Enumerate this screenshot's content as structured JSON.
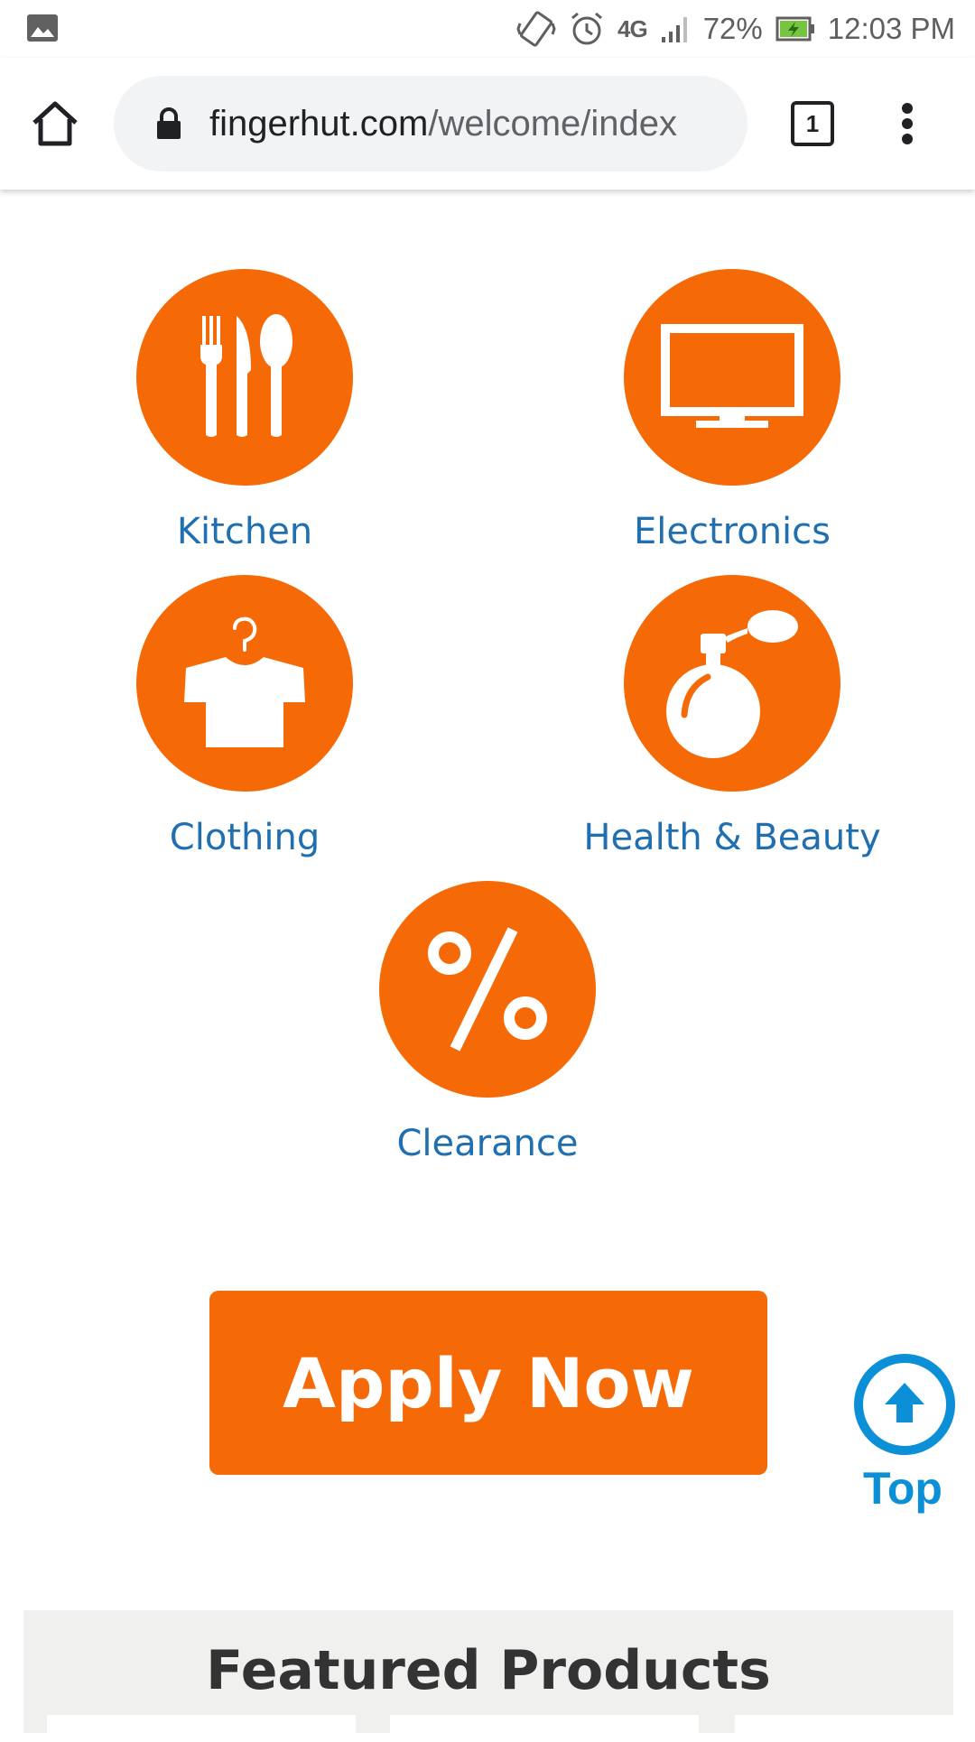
{
  "status_bar": {
    "battery_percent": "72%",
    "time": "12:03 PM",
    "network": "4G",
    "icons": [
      "gallery-icon",
      "vibrate-icon",
      "alarm-icon",
      "lte-icon",
      "signal-icon",
      "battery-charging-icon"
    ]
  },
  "browser": {
    "url_domain": "fingerhut.com",
    "url_path": "/welcome/index",
    "tab_count": "1",
    "icons": [
      "home-icon",
      "lock-icon",
      "tabs-icon",
      "menu-icon"
    ]
  },
  "categories": [
    {
      "label": "Kitchen",
      "icon": "utensils-icon"
    },
    {
      "label": "Electronics",
      "icon": "tv-icon"
    },
    {
      "label": "Clothing",
      "icon": "shirt-icon"
    },
    {
      "label": "Health & Beauty",
      "icon": "perfume-icon"
    },
    {
      "label": "Clearance",
      "icon": "percent-icon"
    }
  ],
  "apply_button": {
    "label": "Apply Now"
  },
  "top_button": {
    "label": "Top",
    "icon": "arrow-up-icon"
  },
  "featured": {
    "title": "Featured Products"
  },
  "colors": {
    "accent_orange": "#f56a06",
    "link_blue": "#1f6fb1",
    "top_blue": "#0b8fd6"
  }
}
